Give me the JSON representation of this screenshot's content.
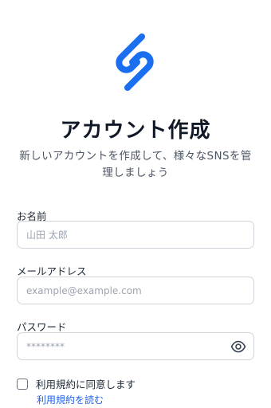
{
  "brand": {
    "accent": "#1a6ff0",
    "logo_icon": "stacked-s-logo"
  },
  "header": {
    "title": "アカウント作成",
    "subtitle_line1": "新しいアカウントを作成して、様々なSNSを管",
    "subtitle_line2": "理しましょう"
  },
  "form": {
    "name": {
      "label": "お名前",
      "placeholder": "山田 太郎",
      "value": ""
    },
    "email": {
      "label": "メールアドレス",
      "placeholder": "example@example.com",
      "value": ""
    },
    "password": {
      "label": "パスワード",
      "placeholder": "********",
      "value": "",
      "toggle_icon": "eye-icon"
    },
    "terms": {
      "checked": false,
      "label": "利用規約に同意します",
      "link_text": "利用規約を読む"
    }
  }
}
